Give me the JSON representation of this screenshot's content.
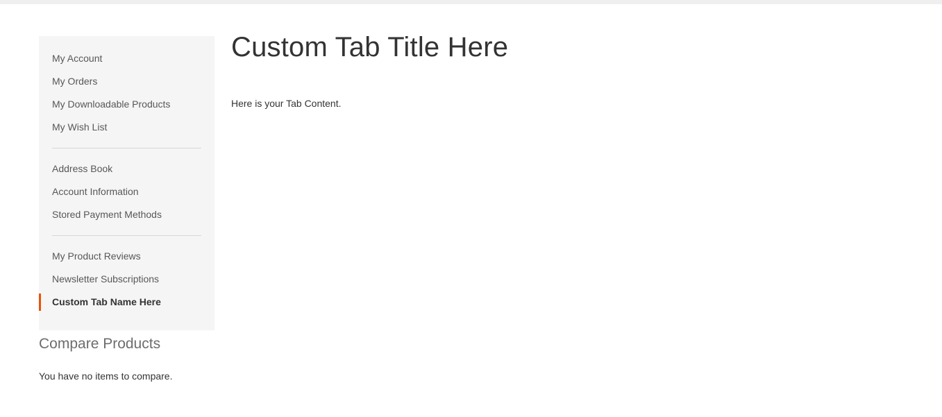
{
  "theme": {
    "accent": "#eb5202",
    "sidebar_bg": "#f5f5f5",
    "top_strip": "#efefef",
    "link_color": "#575757",
    "text_color": "#333333",
    "divider": "#d6d6d6"
  },
  "sidebar": {
    "groups": [
      {
        "items": [
          {
            "label": "My Account",
            "current": false
          },
          {
            "label": "My Orders",
            "current": false
          },
          {
            "label": "My Downloadable Products",
            "current": false
          },
          {
            "label": "My Wish List",
            "current": false
          }
        ]
      },
      {
        "items": [
          {
            "label": "Address Book",
            "current": false
          },
          {
            "label": "Account Information",
            "current": false
          },
          {
            "label": "Stored Payment Methods",
            "current": false
          }
        ]
      },
      {
        "items": [
          {
            "label": "My Product Reviews",
            "current": false
          },
          {
            "label": "Newsletter Subscriptions",
            "current": false
          },
          {
            "label": "Custom Tab Name Here",
            "current": true
          }
        ]
      }
    ]
  },
  "compare": {
    "title": "Compare Products",
    "empty_message": "You have no items to compare."
  },
  "main": {
    "title": "Custom Tab Title Here",
    "content": "Here is your Tab Content."
  }
}
